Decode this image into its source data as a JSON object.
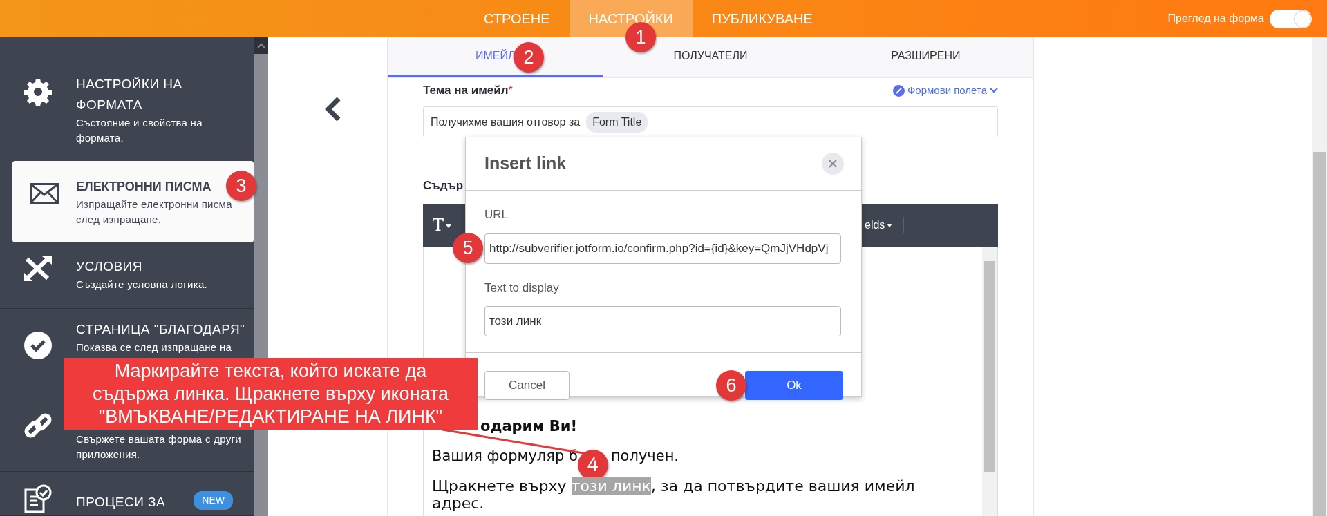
{
  "top_bar": {
    "tabs": [
      {
        "label": "СТРОЕНЕ",
        "selected": false
      },
      {
        "label": "НАСТРОЙКИ",
        "selected": true
      },
      {
        "label": "ПУБЛИКУВАНЕ",
        "selected": false
      }
    ],
    "preview_label": "Преглед на форма",
    "preview_on": true
  },
  "sidebar": {
    "items": [
      {
        "title": "НАСТРОЙКИ НА ФОРМАТА",
        "description": "Състояние и свойства на формата.",
        "selected": false
      },
      {
        "title": "ЕЛЕКТРОННИ ПИСМА",
        "description": "Изпращайте електронни писма след изпращане.",
        "selected": true
      },
      {
        "title": "УСЛОВИЯ",
        "description": "Създайте условна логика.",
        "selected": false
      },
      {
        "title": "СТРАНИЦА \"БЛАГОДАРЯ\"",
        "description": "Показва се след изпращане на",
        "selected": false
      },
      {
        "description": "Свържете вашата форма с други приложения.",
        "selected": false
      },
      {
        "title": "ПРОЦЕСИ ЗА",
        "badge": "NEW",
        "selected": false
      }
    ]
  },
  "email_tabs": [
    {
      "label": "ИМЕЙЛ",
      "selected": true
    },
    {
      "label": "ПОЛУЧАТЕЛИ",
      "selected": false
    },
    {
      "label": "РАЗШИРЕНИ",
      "selected": false
    }
  ],
  "subject": {
    "label": "Тема на имейл",
    "required_mark": "*",
    "fields_link": "Формови полета",
    "value": "Получихме вашия отговор за",
    "chip": "Form Title"
  },
  "content_label": "Съдър",
  "editor": {
    "toolbar": [
      "T",
      "elds"
    ],
    "heading": "одарим Ви!",
    "line2_before": "Вашия формуляр б",
    "line2_after": "получен.",
    "line3": {
      "before": "Щракнете върху ",
      "highlight": "този линк",
      "after": ", за да потвърдите вашия имейл адрес."
    }
  },
  "dialog": {
    "title": "Insert link",
    "fields": [
      {
        "label": "URL",
        "value": "http://subverifier.jotform.io/confirm.php?id={id}&key=QmJjVHdpVj"
      },
      {
        "label": "Text to display",
        "value": "този линк"
      }
    ],
    "buttons": [
      {
        "label": "Cancel",
        "kind": "secondary"
      },
      {
        "label": "Ok",
        "kind": "primary"
      }
    ]
  },
  "callout": {
    "lines": [
      "Маркирайте текста, който искате да",
      "съдържа линка. Щракнете върху иконата",
      "\"ВМЪКВАНЕ/РЕДАКТИРАНЕ НА ЛИНК\""
    ]
  },
  "markers": [
    "1",
    "2",
    "3",
    "4",
    "5",
    "6"
  ]
}
